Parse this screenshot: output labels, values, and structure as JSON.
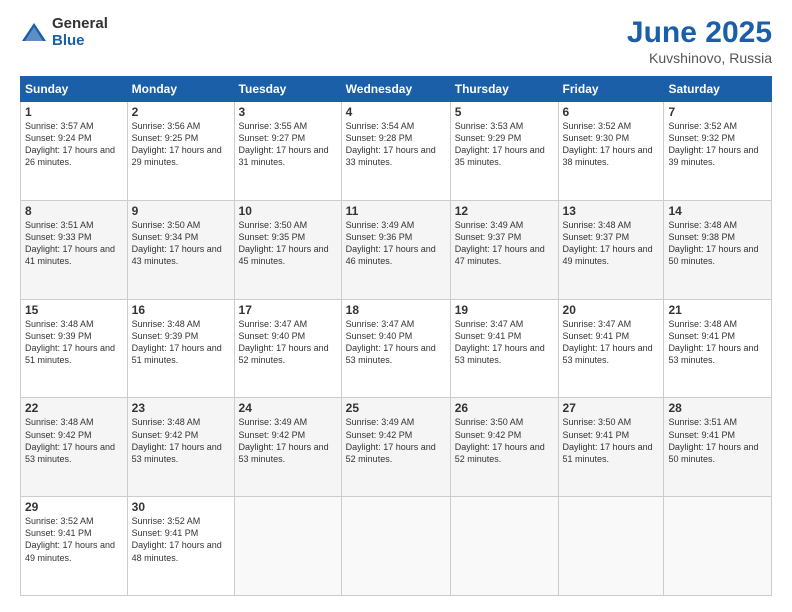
{
  "header": {
    "logo_general": "General",
    "logo_blue": "Blue",
    "month_title": "June 2025",
    "location": "Kuvshinovo, Russia"
  },
  "weekdays": [
    "Sunday",
    "Monday",
    "Tuesday",
    "Wednesday",
    "Thursday",
    "Friday",
    "Saturday"
  ],
  "weeks": [
    [
      {
        "day": "1",
        "sunrise": "3:57 AM",
        "sunset": "9:24 PM",
        "daylight": "17 hours and 26 minutes."
      },
      {
        "day": "2",
        "sunrise": "3:56 AM",
        "sunset": "9:25 PM",
        "daylight": "17 hours and 29 minutes."
      },
      {
        "day": "3",
        "sunrise": "3:55 AM",
        "sunset": "9:27 PM",
        "daylight": "17 hours and 31 minutes."
      },
      {
        "day": "4",
        "sunrise": "3:54 AM",
        "sunset": "9:28 PM",
        "daylight": "17 hours and 33 minutes."
      },
      {
        "day": "5",
        "sunrise": "3:53 AM",
        "sunset": "9:29 PM",
        "daylight": "17 hours and 35 minutes."
      },
      {
        "day": "6",
        "sunrise": "3:52 AM",
        "sunset": "9:30 PM",
        "daylight": "17 hours and 38 minutes."
      },
      {
        "day": "7",
        "sunrise": "3:52 AM",
        "sunset": "9:32 PM",
        "daylight": "17 hours and 39 minutes."
      }
    ],
    [
      {
        "day": "8",
        "sunrise": "3:51 AM",
        "sunset": "9:33 PM",
        "daylight": "17 hours and 41 minutes."
      },
      {
        "day": "9",
        "sunrise": "3:50 AM",
        "sunset": "9:34 PM",
        "daylight": "17 hours and 43 minutes."
      },
      {
        "day": "10",
        "sunrise": "3:50 AM",
        "sunset": "9:35 PM",
        "daylight": "17 hours and 45 minutes."
      },
      {
        "day": "11",
        "sunrise": "3:49 AM",
        "sunset": "9:36 PM",
        "daylight": "17 hours and 46 minutes."
      },
      {
        "day": "12",
        "sunrise": "3:49 AM",
        "sunset": "9:37 PM",
        "daylight": "17 hours and 47 minutes."
      },
      {
        "day": "13",
        "sunrise": "3:48 AM",
        "sunset": "9:37 PM",
        "daylight": "17 hours and 49 minutes."
      },
      {
        "day": "14",
        "sunrise": "3:48 AM",
        "sunset": "9:38 PM",
        "daylight": "17 hours and 50 minutes."
      }
    ],
    [
      {
        "day": "15",
        "sunrise": "3:48 AM",
        "sunset": "9:39 PM",
        "daylight": "17 hours and 51 minutes."
      },
      {
        "day": "16",
        "sunrise": "3:48 AM",
        "sunset": "9:39 PM",
        "daylight": "17 hours and 51 minutes."
      },
      {
        "day": "17",
        "sunrise": "3:47 AM",
        "sunset": "9:40 PM",
        "daylight": "17 hours and 52 minutes."
      },
      {
        "day": "18",
        "sunrise": "3:47 AM",
        "sunset": "9:40 PM",
        "daylight": "17 hours and 53 minutes."
      },
      {
        "day": "19",
        "sunrise": "3:47 AM",
        "sunset": "9:41 PM",
        "daylight": "17 hours and 53 minutes."
      },
      {
        "day": "20",
        "sunrise": "3:47 AM",
        "sunset": "9:41 PM",
        "daylight": "17 hours and 53 minutes."
      },
      {
        "day": "21",
        "sunrise": "3:48 AM",
        "sunset": "9:41 PM",
        "daylight": "17 hours and 53 minutes."
      }
    ],
    [
      {
        "day": "22",
        "sunrise": "3:48 AM",
        "sunset": "9:42 PM",
        "daylight": "17 hours and 53 minutes."
      },
      {
        "day": "23",
        "sunrise": "3:48 AM",
        "sunset": "9:42 PM",
        "daylight": "17 hours and 53 minutes."
      },
      {
        "day": "24",
        "sunrise": "3:49 AM",
        "sunset": "9:42 PM",
        "daylight": "17 hours and 53 minutes."
      },
      {
        "day": "25",
        "sunrise": "3:49 AM",
        "sunset": "9:42 PM",
        "daylight": "17 hours and 52 minutes."
      },
      {
        "day": "26",
        "sunrise": "3:50 AM",
        "sunset": "9:42 PM",
        "daylight": "17 hours and 52 minutes."
      },
      {
        "day": "27",
        "sunrise": "3:50 AM",
        "sunset": "9:41 PM",
        "daylight": "17 hours and 51 minutes."
      },
      {
        "day": "28",
        "sunrise": "3:51 AM",
        "sunset": "9:41 PM",
        "daylight": "17 hours and 50 minutes."
      }
    ],
    [
      {
        "day": "29",
        "sunrise": "3:52 AM",
        "sunset": "9:41 PM",
        "daylight": "17 hours and 49 minutes."
      },
      {
        "day": "30",
        "sunrise": "3:52 AM",
        "sunset": "9:41 PM",
        "daylight": "17 hours and 48 minutes."
      },
      null,
      null,
      null,
      null,
      null
    ]
  ]
}
